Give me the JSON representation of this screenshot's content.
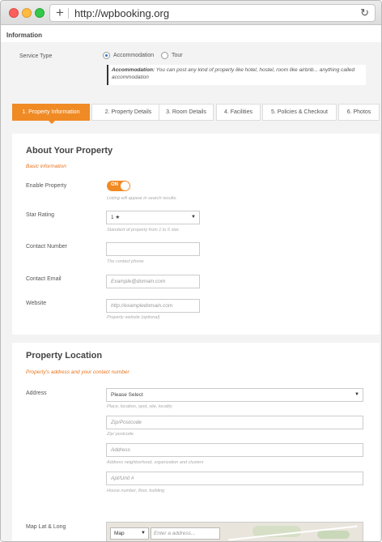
{
  "browser": {
    "url": "http://wpbooking.org"
  },
  "page": {
    "title": "Information"
  },
  "service_type": {
    "label": "Service Type",
    "options": [
      {
        "label": "Accommodation",
        "checked": true
      },
      {
        "label": "Tour",
        "checked": false
      }
    ],
    "note_title": "Accommodation:",
    "note_text": "You can post any kind of property like hotel, hostel, room like airbnb... anything called accommodation"
  },
  "tabs": [
    {
      "label": "1. Property Information",
      "active": true
    },
    {
      "label": "2. Property Details",
      "active": false
    },
    {
      "label": "3. Room Details",
      "active": false
    },
    {
      "label": "4. Facilities",
      "active": false
    },
    {
      "label": "5. Policies & Checkout",
      "active": false
    },
    {
      "label": "6. Photos",
      "active": false
    }
  ],
  "about": {
    "title": "About Your Property",
    "subtitle": "Basic information",
    "enable": {
      "label": "Enable Property",
      "toggle": "ON",
      "help": "Listing will appear in search results."
    },
    "star": {
      "label": "Star Rating",
      "value": "1 ★",
      "help": "Standard of property from 1 to 5 star."
    },
    "contact_number": {
      "label": "Contact Number",
      "value": "",
      "help": "The contact phone"
    },
    "contact_email": {
      "label": "Contact Email",
      "placeholder": "Example@domain.com"
    },
    "website": {
      "label": "Website",
      "placeholder": "http://exampledomain.com",
      "help": "Property website (optional)"
    }
  },
  "location": {
    "title": "Property Location",
    "subtitle": "Property's address and your contact number",
    "address": {
      "label": "Address",
      "select_value": "Please Select",
      "select_help": "Place, location, spot, site, locality",
      "zip_placeholder": "Zip/Postcode",
      "zip_help": "Zip/ postcode",
      "address_placeholder": "Address",
      "address_help": "Address neighborhood, organization and clusters",
      "apt_placeholder": "Apt/Unit #",
      "apt_help": "House number, floor, building"
    },
    "map": {
      "label": "Map Lat & Long",
      "type": "Map",
      "search_placeholder": "Enter a address..."
    }
  }
}
